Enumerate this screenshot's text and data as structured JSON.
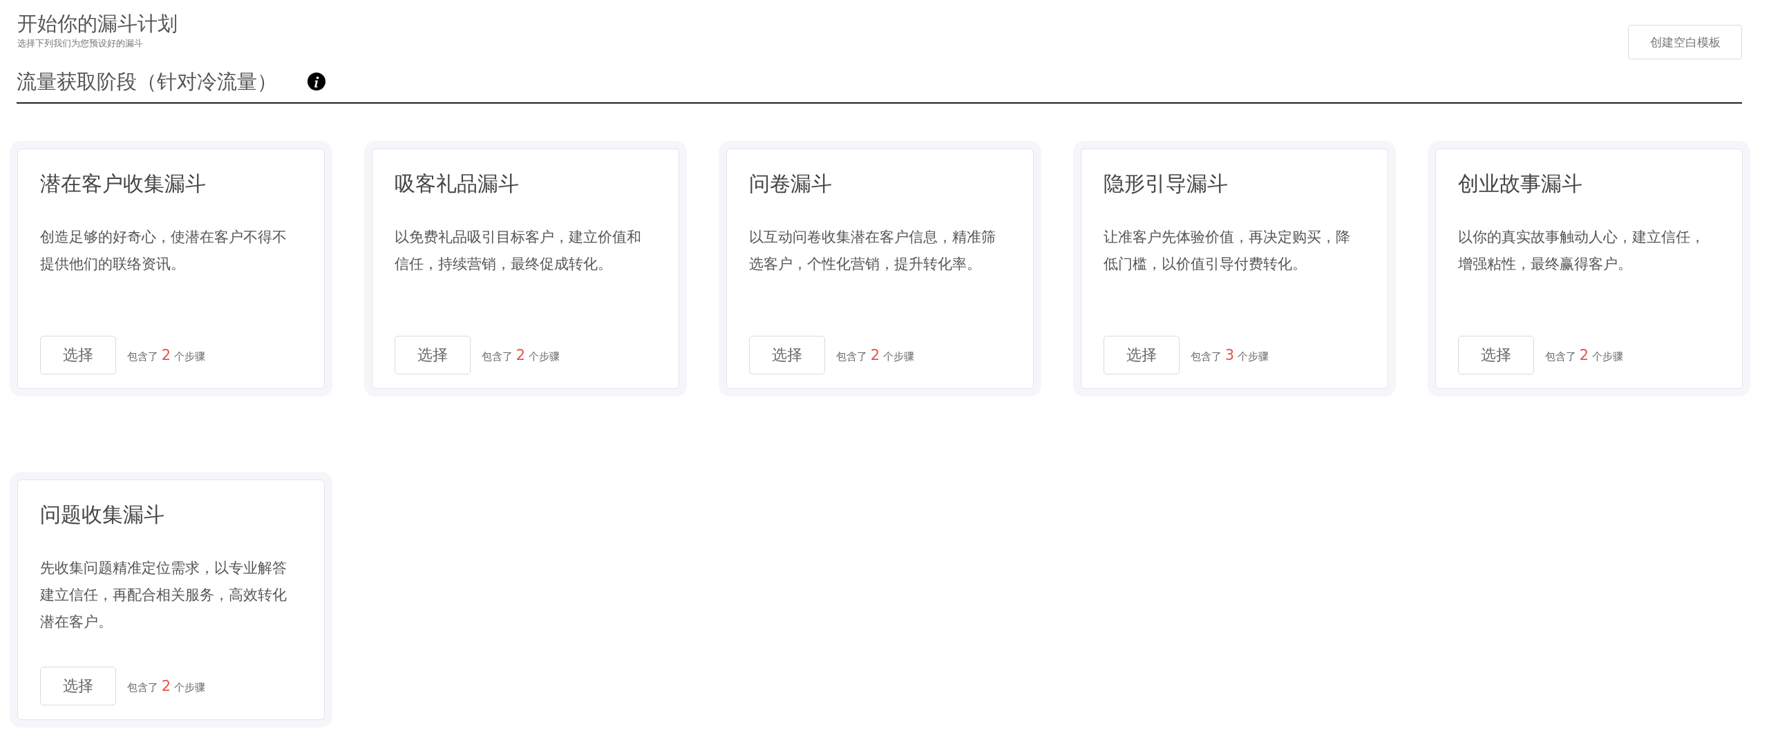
{
  "header": {
    "title": "开始你的漏斗计划",
    "subtitle": "选择下列我们为您预设好的漏斗",
    "create_button": "创建空白模板"
  },
  "section": {
    "title": "流量获取阶段（针对冷流量）"
  },
  "templates": [
    {
      "title": "潜在客户收集漏斗",
      "description": "创造足够的好奇心，使潜在客户不得不提供他们的联络资讯。",
      "button": "选择",
      "steps_prefix": "包含了",
      "steps_count": "2",
      "steps_suffix": "个步骤"
    },
    {
      "title": "吸客礼品漏斗",
      "description": "以免费礼品吸引目标客户，建立价值和信任，持续营销，最终促成转化。",
      "button": "选择",
      "steps_prefix": "包含了",
      "steps_count": "2",
      "steps_suffix": "个步骤"
    },
    {
      "title": "问卷漏斗",
      "description": "以互动问卷收集潜在客户信息，精准筛选客户，个性化营销，提升转化率。",
      "button": "选择",
      "steps_prefix": "包含了",
      "steps_count": "2",
      "steps_suffix": "个步骤"
    },
    {
      "title": "隐形引导漏斗",
      "description": "让准客户先体验价值，再决定购买，降低门槛，以价值引导付费转化。",
      "button": "选择",
      "steps_prefix": "包含了",
      "steps_count": "3",
      "steps_suffix": "个步骤"
    },
    {
      "title": "创业故事漏斗",
      "description": "以你的真实故事触动人心，建立信任，增强粘性，最终赢得客户。",
      "button": "选择",
      "steps_prefix": "包含了",
      "steps_count": "2",
      "steps_suffix": "个步骤"
    },
    {
      "title": "问题收集漏斗",
      "description": "先收集问题精准定位需求，以专业解答建立信任，再配合相关服务，高效转化潜在客户。",
      "button": "选择",
      "steps_prefix": "包含了",
      "steps_count": "2",
      "steps_suffix": "个步骤"
    }
  ]
}
